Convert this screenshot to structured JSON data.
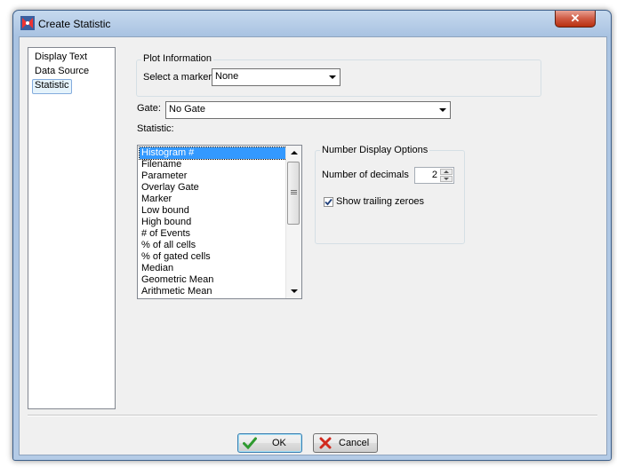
{
  "window": {
    "title": "Create Statistic"
  },
  "nav": {
    "items": [
      "Display Text",
      "Data Source",
      "Statistic"
    ],
    "selected_index": 2
  },
  "plot_info": {
    "group_label": "Plot Information",
    "marker_label": "Select a marker",
    "marker_value": "None"
  },
  "gate": {
    "label": "Gate:",
    "value": "No Gate"
  },
  "statistic": {
    "label": "Statistic:",
    "items": [
      "Histogram #",
      "Filename",
      "Parameter",
      "Overlay Gate",
      "Marker",
      "Low bound",
      "High bound",
      "# of Events",
      "% of all cells",
      "% of gated cells",
      "Median",
      "Geometric Mean",
      "Arithmetic Mean"
    ],
    "selected_index": 0
  },
  "number_display": {
    "group_label": "Number Display Options",
    "decimals_label": "Number of decimals",
    "decimals_value": "2",
    "trailing_label": "Show trailing zeroes",
    "trailing_checked": true
  },
  "buttons": {
    "ok": "OK",
    "cancel": "Cancel"
  },
  "colors": {
    "selection": "#3399ff",
    "ok_check": "#2f9a2f",
    "cancel_x": "#d12a1e"
  }
}
